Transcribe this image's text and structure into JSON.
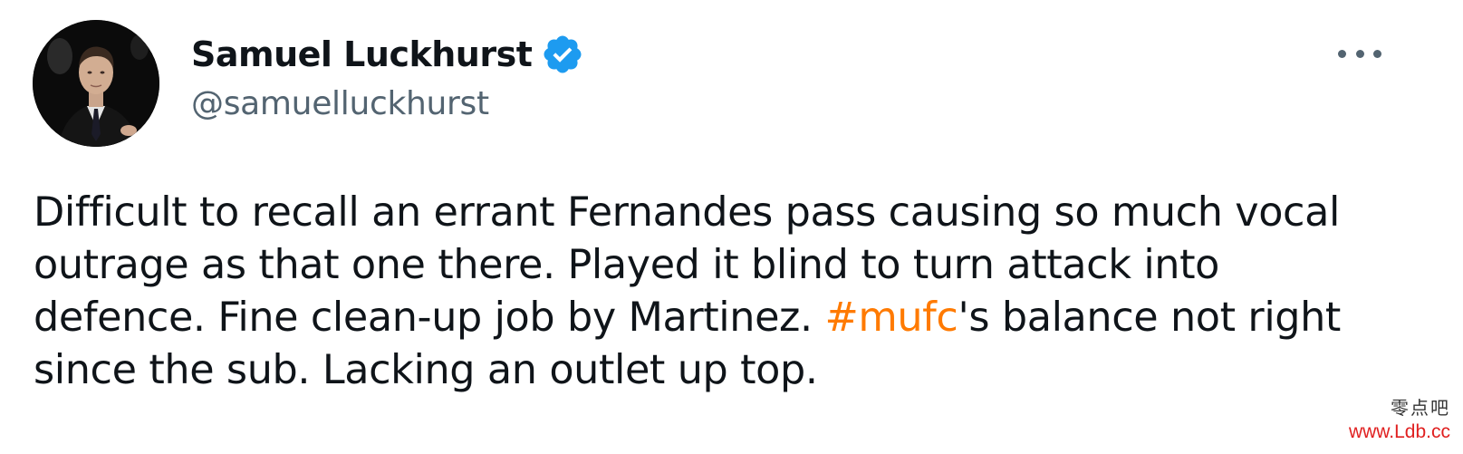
{
  "author": {
    "display_name": "Samuel Luckhurst",
    "handle": "@samuelluckhurst",
    "verified": true,
    "verified_color": "#1d9bf0"
  },
  "icons": {
    "avatar": "profile-photo",
    "verified": "verified-badge-icon",
    "more": "more-options-icon"
  },
  "tweet": {
    "lines": [
      "Difficult to recall an errant Fernandes pass causing so much vocal",
      "outrage as that one there. Played it blind to turn attack into"
    ],
    "line3_before": "defence. Fine clean-up job by Martinez. ",
    "hashtag": "#mufc",
    "line3_after": "'s balance not right",
    "line4": "since the sub. Lacking an outlet up top.",
    "hashtag_color": "#ff7a00"
  },
  "watermark": {
    "chinese": "零点吧",
    "url": "www.Ldb.cc"
  }
}
